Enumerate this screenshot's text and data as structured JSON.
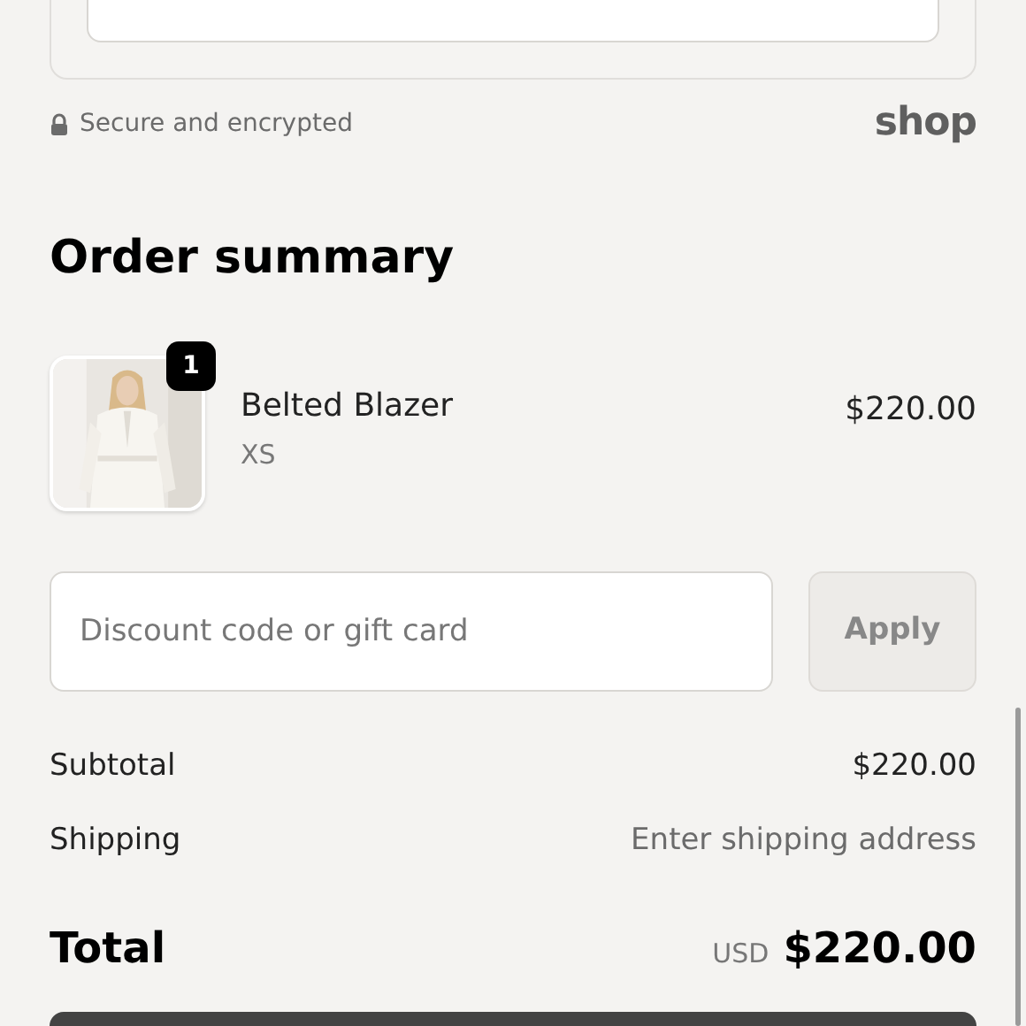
{
  "secure_note": "Secure and encrypted",
  "shop_logo": "shop",
  "order_summary": {
    "title": "Order summary",
    "items": [
      {
        "name": "Belted Blazer",
        "variant": "XS",
        "price": "$220.00",
        "quantity": "1"
      }
    ],
    "discount": {
      "placeholder": "Discount code or gift card",
      "button": "Apply",
      "disabled": true
    },
    "lines": [
      {
        "label": "Subtotal",
        "value": "$220.00",
        "kind": "amount"
      },
      {
        "label": "Shipping",
        "value": "Enter shipping address",
        "kind": "note"
      }
    ],
    "total": {
      "label": "Total",
      "currency": "USD",
      "value": "$220.00"
    }
  }
}
